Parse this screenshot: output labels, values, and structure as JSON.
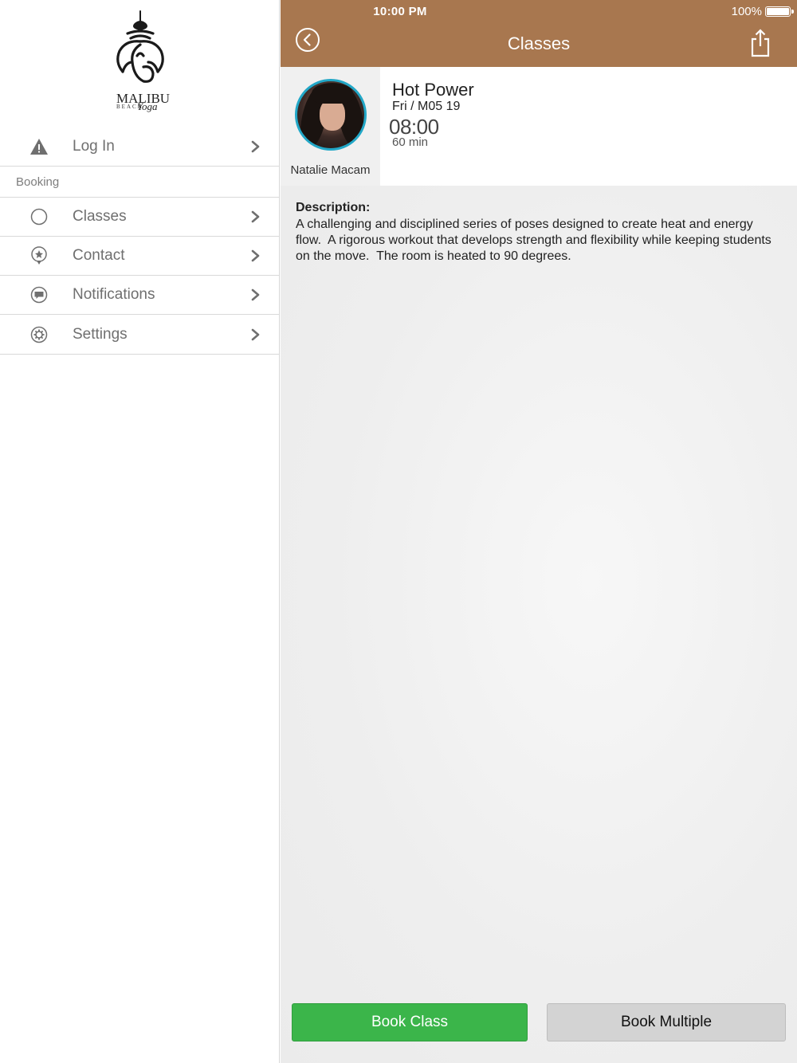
{
  "status_bar": {
    "time": "10:00 PM",
    "battery": "100%"
  },
  "sidebar": {
    "logo": {
      "name": "MALIBU",
      "sub": "BEACH",
      "script": "Yoga"
    },
    "login": {
      "label": "Log In",
      "icon": "warning-icon"
    },
    "section_label": "Booking",
    "items": [
      {
        "label": "Classes",
        "icon": "circle-icon"
      },
      {
        "label": "Contact",
        "icon": "location-pin-icon"
      },
      {
        "label": "Notifications",
        "icon": "chat-bubble-icon"
      },
      {
        "label": "Settings",
        "icon": "gear-icon"
      }
    ]
  },
  "navbar": {
    "title": "Classes",
    "back_icon": "back-icon",
    "share_icon": "share-icon"
  },
  "class": {
    "name": "Hot Power",
    "date": "Fri / M05 19",
    "time": "08:00",
    "duration": "60 min",
    "instructor": "Natalie Macam"
  },
  "description": {
    "heading": "Description:",
    "text": "A challenging and disciplined series of poses designed to create heat and energy flow.  A rigorous workout that develops strength and flexibility while keeping students on the move.  The room is heated to 90 degrees."
  },
  "buttons": {
    "book": "Book Class",
    "book_multiple": "Book Multiple"
  },
  "colors": {
    "navbar": "#a8774f",
    "book_button": "#3bb54a",
    "avatar_ring": "#22a7c7"
  }
}
